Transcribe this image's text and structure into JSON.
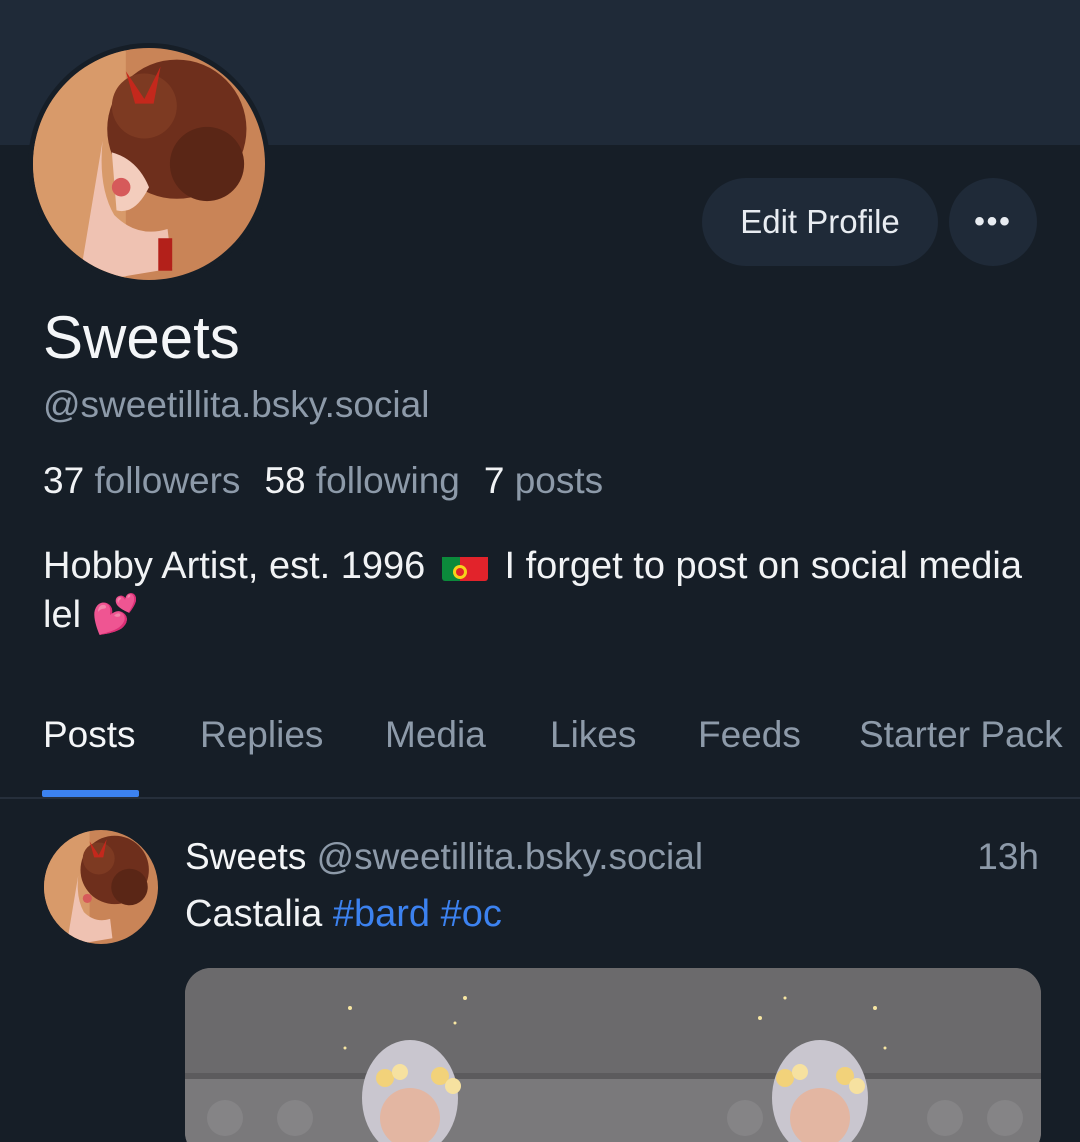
{
  "profile": {
    "display_name": "Sweets",
    "handle": "@sweetillita.bsky.social",
    "stats": {
      "followers_count": "37",
      "followers_label": "followers",
      "following_count": "58",
      "following_label": "following",
      "posts_count": "7",
      "posts_label": "posts"
    },
    "bio_part1": "Hobby Artist, est. 1996",
    "bio_flag": "portugal-flag",
    "bio_part2": "I forget to post on social media lel",
    "bio_emoji": "💕"
  },
  "actions": {
    "edit_profile_label": "Edit Profile",
    "more_label": "•••"
  },
  "tabs": [
    {
      "label": "Posts",
      "active": true
    },
    {
      "label": "Replies",
      "active": false
    },
    {
      "label": "Media",
      "active": false
    },
    {
      "label": "Likes",
      "active": false
    },
    {
      "label": "Feeds",
      "active": false
    },
    {
      "label": "Starter Pack",
      "active": false
    }
  ],
  "post": {
    "author": "Sweets",
    "handle": "@sweetillita.bsky.social",
    "time": "13h",
    "text": "Castalia",
    "hashtags": [
      "#bard",
      "#oc"
    ]
  },
  "colors": {
    "background": "#161e27",
    "banner": "#1f2a38",
    "accent": "#3c82f0",
    "muted_text": "#8d9aa9"
  }
}
